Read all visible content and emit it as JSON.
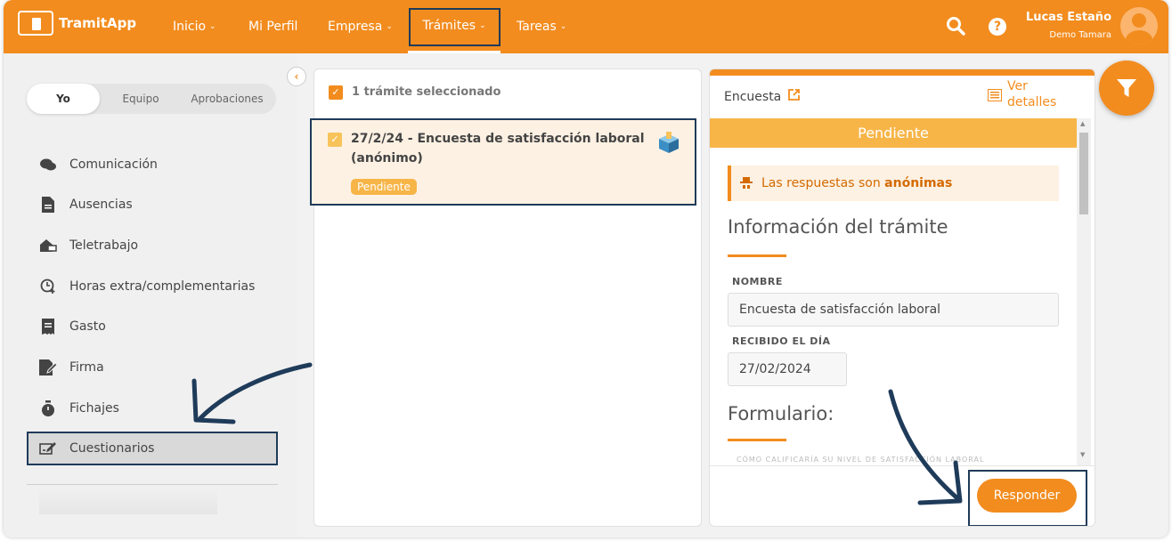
{
  "app": {
    "logo_text": "TramitApp"
  },
  "nav": {
    "items": [
      {
        "label": "Inicio",
        "has_chevron": true
      },
      {
        "label": "Mi Perfil",
        "has_chevron": false
      },
      {
        "label": "Empresa",
        "has_chevron": true
      },
      {
        "label": "Trámites",
        "has_chevron": true,
        "active": true
      },
      {
        "label": "Tareas",
        "has_chevron": true
      }
    ],
    "chevron": "⌄"
  },
  "user": {
    "name": "Lucas Estaño",
    "company": "Demo Tamara"
  },
  "sidebar": {
    "segments": [
      {
        "label": "Yo",
        "active": true
      },
      {
        "label": "Equipo"
      },
      {
        "label": "Aprobaciones"
      }
    ],
    "items": [
      {
        "label": "Comunicación",
        "icon": "chat-bubbles-icon"
      },
      {
        "label": "Ausencias",
        "icon": "document-icon"
      },
      {
        "label": "Teletrabajo",
        "icon": "home-computer-icon"
      },
      {
        "label": "Horas extra/complementarias",
        "icon": "clock-plus-icon"
      },
      {
        "label": "Gasto",
        "icon": "receipt-icon"
      },
      {
        "label": "Firma",
        "icon": "signature-icon"
      },
      {
        "label": "Fichajes",
        "icon": "stopwatch-icon"
      },
      {
        "label": "Cuestionarios",
        "icon": "edit-form-icon",
        "highlighted": true
      }
    ]
  },
  "list": {
    "selected_text": "1 trámite seleccionado",
    "item": {
      "title": "27/2/24 - Encuesta de satisfacción laboral (anónimo)",
      "status": "Pendiente",
      "icon": "ballot-box-icon"
    }
  },
  "detail": {
    "type_label": "Encuesta",
    "view_details": "Ver detalles",
    "status": "Pendiente",
    "anon_prefix": "Las respuestas son",
    "anon_bold": "anónimas",
    "info_title": "Información del trámite",
    "name_label": "NOMBRE",
    "name_value": "Encuesta de satisfacción laboral",
    "received_label": "RECIBIDO EL DÍA",
    "received_value": "27/02/2024",
    "form_title": "Formulario:",
    "faded_text": "CÓMO CALIFICARÍA SU NIVEL DE SATISFACCIÓN LABORAL",
    "respond_button": "Responder"
  },
  "colors": {
    "brand": "#f28c1e",
    "pending": "#f7b548",
    "annotation": "#1f3b5a"
  }
}
